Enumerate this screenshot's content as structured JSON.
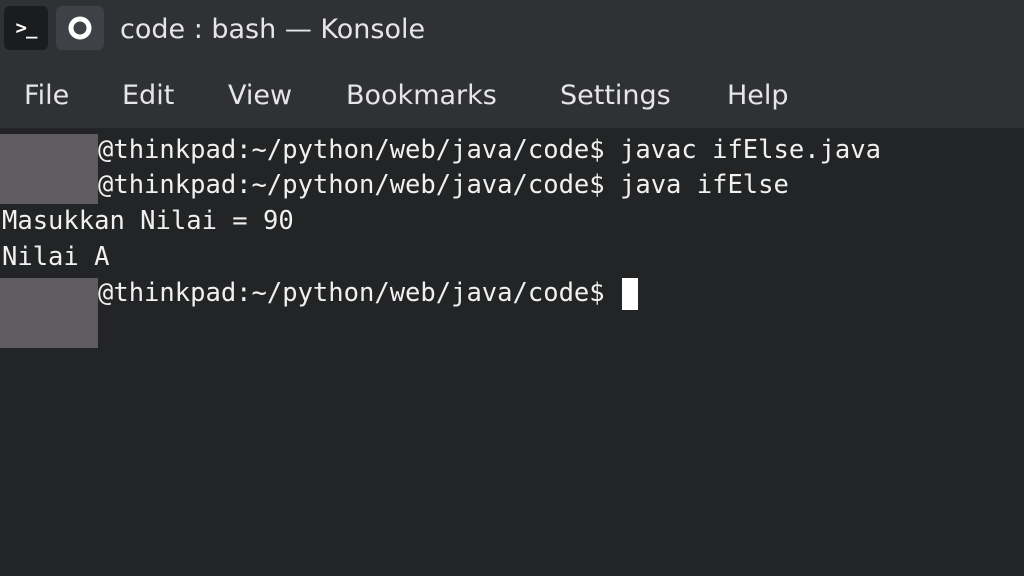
{
  "app": {
    "icon_glyph": ">_",
    "icon_name": "terminal-icon",
    "pin_icon_name": "pin-icon",
    "title": "code : bash — Konsole"
  },
  "menu": {
    "items": [
      {
        "label": "File"
      },
      {
        "label": "Edit"
      },
      {
        "label": "View"
      },
      {
        "label": "Bookmarks"
      },
      {
        "label": "Settings"
      },
      {
        "label": "Help"
      }
    ]
  },
  "terminal": {
    "lines": [
      {
        "prompt": "@thinkpad:~/python/web/java/code$",
        "command": " javac ifElse.java"
      },
      {
        "prompt": "@thinkpad:~/python/web/java/code$",
        "command": " java ifElse"
      },
      {
        "output": "Masukkan Nilai = 90"
      },
      {
        "output": "Nilai A"
      },
      {
        "prompt": "@thinkpad:~/python/web/java/code$",
        "command": " "
      }
    ]
  },
  "colors": {
    "background": "#232425",
    "chrome": "#2f3134",
    "text": "#f0f0f0",
    "redaction": "#5e5c5f"
  }
}
